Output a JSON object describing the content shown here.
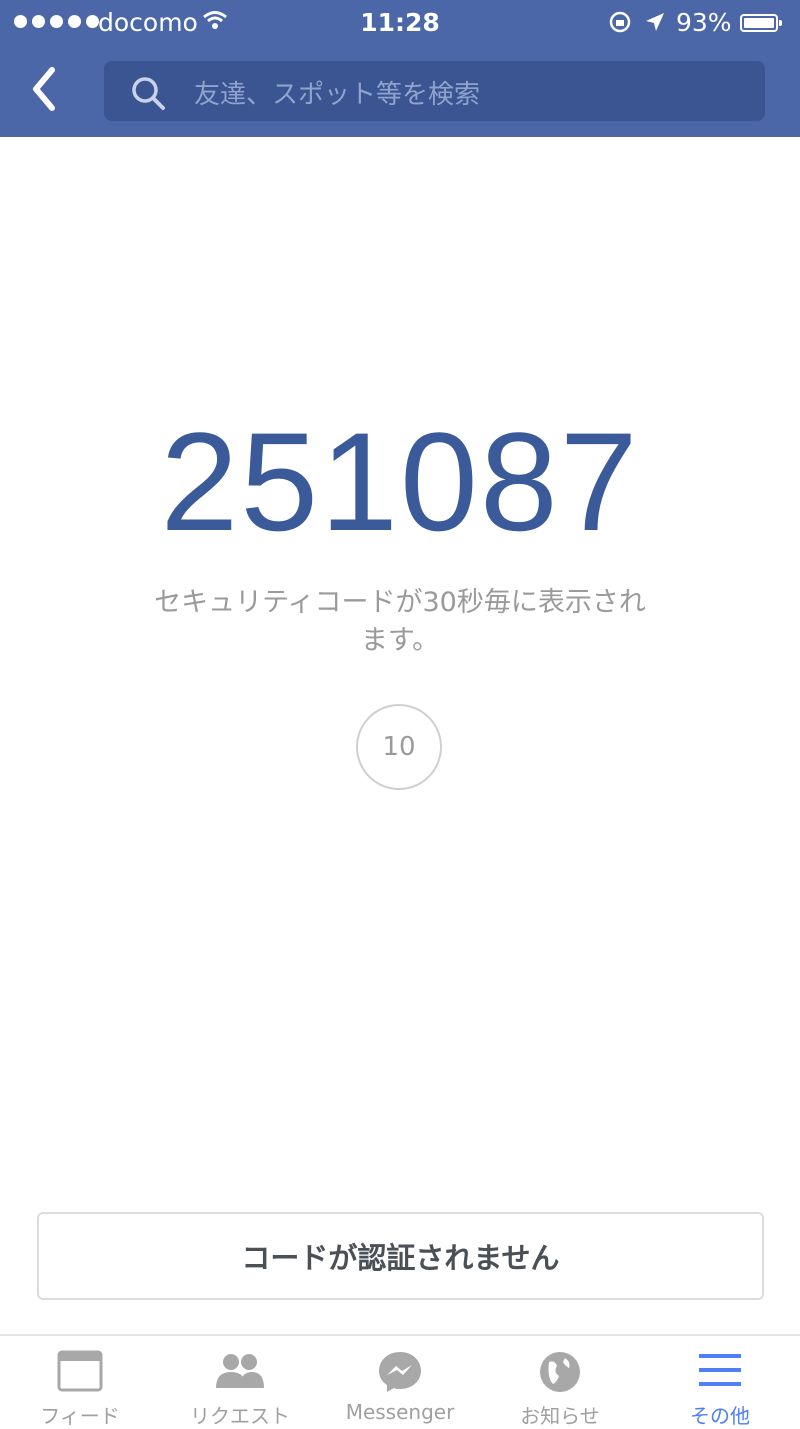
{
  "status_bar": {
    "carrier": "docomo",
    "time": "11:28",
    "battery_percent": "93%",
    "icons": [
      "signal-dots-icon",
      "wifi-icon",
      "rotation-lock-icon",
      "location-arrow-icon",
      "battery-icon"
    ]
  },
  "header": {
    "back_icon": "chevron-left-icon",
    "search": {
      "placeholder": "友達、スポット等を検索",
      "icon": "search-icon"
    },
    "color": "#4b67a8"
  },
  "main": {
    "security_code": "251087",
    "caption": "セキュリティコードが30秒毎に表示されます。",
    "countdown": "10",
    "code_color": "#3b5a9a",
    "not_received_button": "コードが認証されません"
  },
  "tab_bar": {
    "active_color": "#4f7ef5",
    "tabs": [
      {
        "label": "フィード",
        "icon": "news-feed-icon",
        "active": false
      },
      {
        "label": "リクエスト",
        "icon": "friend-requests-icon",
        "active": false
      },
      {
        "label": "Messenger",
        "icon": "messenger-icon",
        "active": false
      },
      {
        "label": "お知らせ",
        "icon": "globe-icon",
        "active": false
      },
      {
        "label": "その他",
        "icon": "menu-icon",
        "active": true
      }
    ]
  }
}
